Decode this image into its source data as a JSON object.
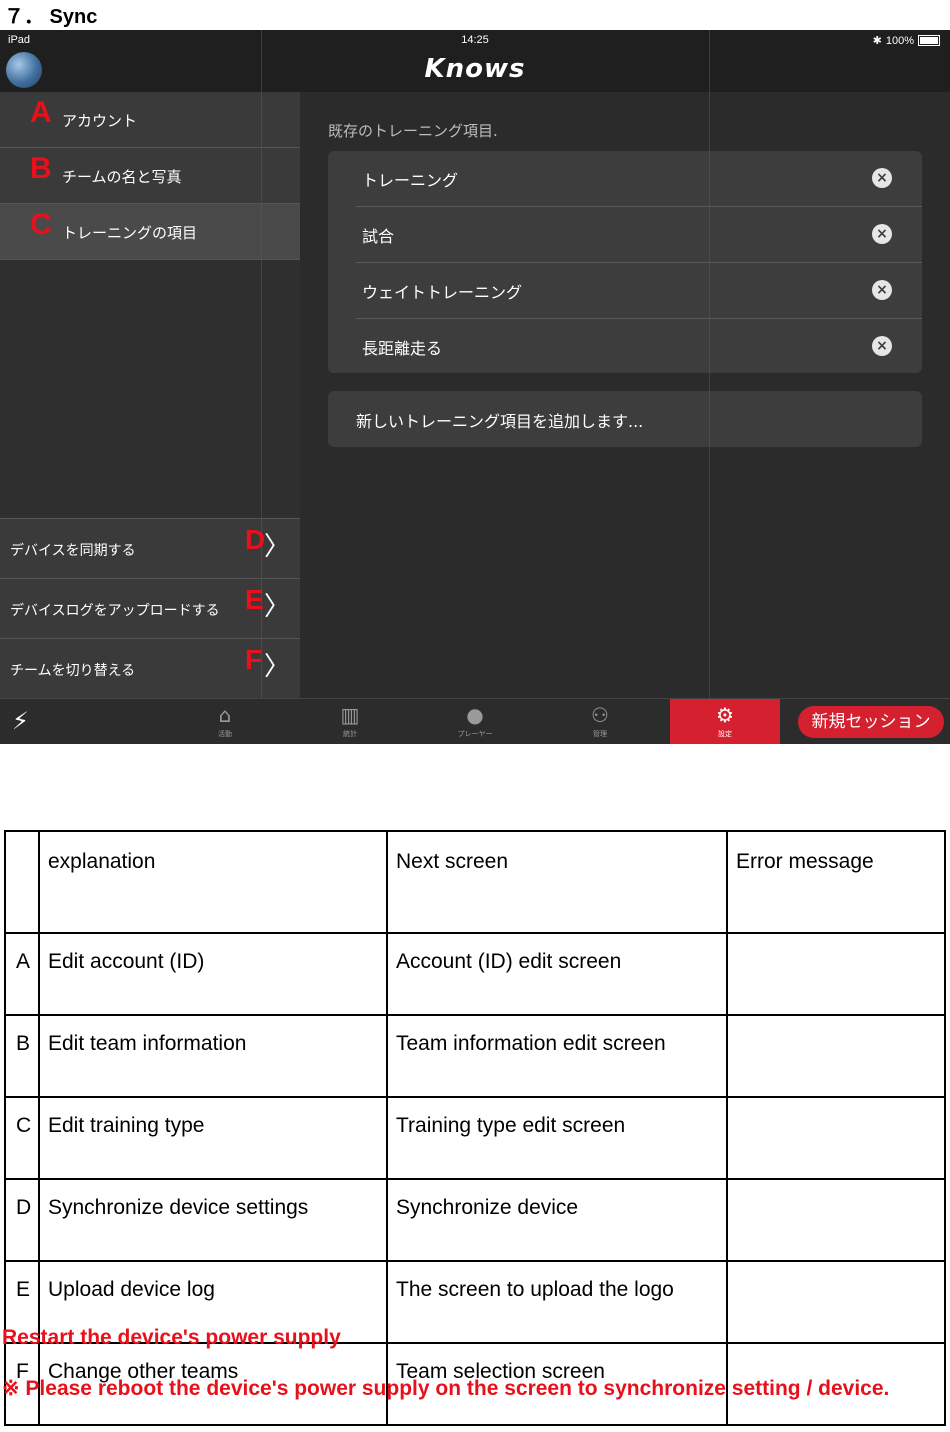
{
  "section_title": "７． Sync",
  "ipad": {
    "status": {
      "device": "iPad",
      "time": "14:25",
      "battery": "100%"
    },
    "app_title": "Knows",
    "sidebar": {
      "items": [
        {
          "letter": "A",
          "label": "アカウント"
        },
        {
          "letter": "B",
          "label": "チームの名と写真"
        },
        {
          "letter": "C",
          "label": "トレーニングの項目"
        }
      ],
      "actions": [
        {
          "letter": "D",
          "label": "デバイスを同期する"
        },
        {
          "letter": "E",
          "label": "デバイスログをアップロードする"
        },
        {
          "letter": "F",
          "label": "チームを切り替える"
        }
      ]
    },
    "content": {
      "heading": "既存のトレーニング項目.",
      "items": [
        "トレーニング",
        "試合",
        "ウェイトトレーニング",
        "長距離走る"
      ],
      "add_label": "新しいトレーニング項目を追加します..."
    },
    "tabbar": {
      "tabs": [
        "活動",
        "統計",
        "プレーヤー",
        "管理",
        "設定"
      ],
      "new_session": "新規セッション"
    }
  },
  "table": {
    "headers": [
      "",
      "explanation",
      "Next screen",
      "Error message"
    ],
    "rows": [
      [
        "A",
        "Edit account (ID)",
        "Account (ID) edit screen",
        ""
      ],
      [
        "B",
        "Edit team information",
        "Team information edit screen",
        ""
      ],
      [
        "C",
        "Edit training type",
        "Training type edit screen",
        ""
      ],
      [
        "D",
        "Synchronize device settings",
        "Synchronize device",
        ""
      ],
      [
        "E",
        "Upload device log",
        "The screen to upload the logo",
        ""
      ],
      [
        "F",
        "Change other teams",
        "Team selection screen",
        ""
      ]
    ]
  },
  "footer": {
    "line1": "Restart the device's power supply",
    "line2": "※ Please reboot the device's power supply on the screen to synchronize setting / device."
  }
}
